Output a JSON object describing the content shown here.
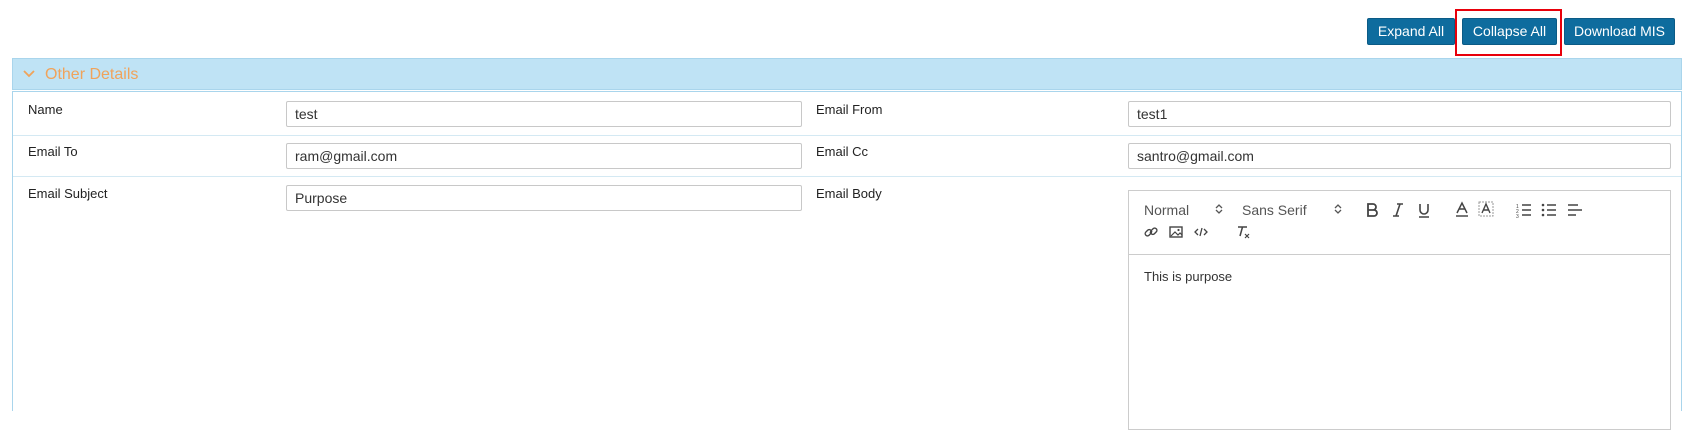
{
  "toolbar": {
    "expand_all": "Expand All",
    "collapse_all": "Collapse All",
    "download_mis": "Download MIS"
  },
  "panel": {
    "title": "Other Details"
  },
  "form": {
    "name_label": "Name",
    "name_value": "test",
    "email_from_label": "Email From",
    "email_from_value": "test1",
    "email_to_label": "Email To",
    "email_to_value": "ram@gmail.com",
    "email_cc_label": "Email Cc",
    "email_cc_value": "santro@gmail.com",
    "email_subject_label": "Email Subject",
    "email_subject_value": "Purpose",
    "email_body_label": "Email Body"
  },
  "editor": {
    "header_select": "Normal",
    "font_select": "Sans Serif",
    "body_text": "This is purpose"
  },
  "colors": {
    "button": "#0e6c9e",
    "panel_header": "#bfe3f5",
    "panel_title": "#f0a35a",
    "highlight": "#e8000b"
  },
  "icons": [
    "chevron-down-icon",
    "select-arrows-icon",
    "bold-icon",
    "italic-icon",
    "underline-icon",
    "font-color-icon",
    "background-color-icon",
    "ordered-list-icon",
    "bullet-list-icon",
    "align-icon",
    "link-icon",
    "image-icon",
    "code-icon",
    "clear-format-icon"
  ]
}
